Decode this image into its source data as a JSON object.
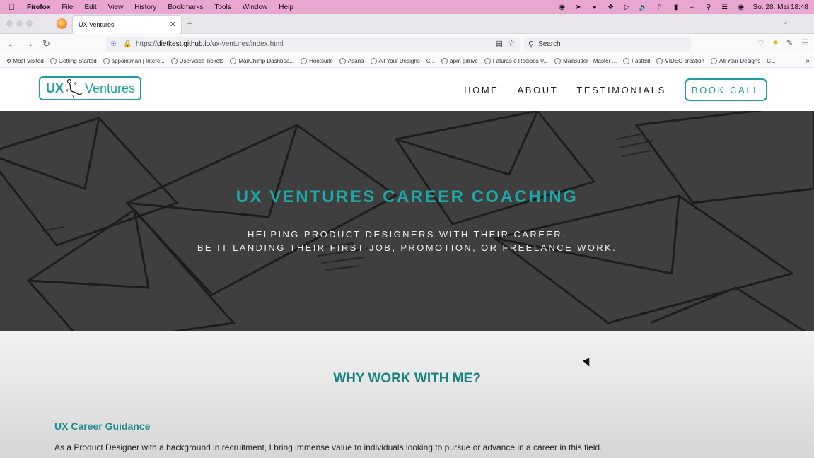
{
  "menubar": {
    "app": "Firefox",
    "items": [
      "File",
      "Edit",
      "View",
      "History",
      "Bookmarks",
      "Tools",
      "Window",
      "Help"
    ],
    "clock": "So. 28. Mai  18:48"
  },
  "browser": {
    "tab_title": "UX Ventures",
    "url_prefix": "https://",
    "url_domain": "dietkest.github.io",
    "url_path": "/ux-ventures/index.html",
    "search_placeholder": "Search"
  },
  "bookmarks": [
    "Most Visited",
    "Getting Started",
    "appointman | Interc...",
    "Uservoice Tickets",
    "MailChimp Dashboa...",
    "Hootsuite",
    "Asana",
    "All Your Designs – C...",
    "apm gdrive",
    "Faturas e Recibos V...",
    "MailButler - Master ...",
    "FastBill",
    "VIDEO creation",
    "All Your Designs – C..."
  ],
  "site": {
    "logo_left": "UX",
    "logo_right": "Ventures",
    "nav": [
      "HOME",
      "ABOUT",
      "TESTIMONIALS"
    ],
    "cta": "BOOK CALL",
    "hero_title": "UX VENTURES CAREER COACHING",
    "hero_line1": "HELPING PRODUCT DESIGNERS WITH THEIR CAREER.",
    "hero_line2": "BE IT LANDING THEIR FIRST JOB, PROMOTION, OR FREELANCE WORK.",
    "why_title": "WHY WORK WITH ME?",
    "section_title": "UX Career Guidance",
    "section_text": "As a Product Designer with a background in recruitment, I bring immense value to individuals looking to pursue or advance in a career in this field."
  },
  "colors": {
    "menubar": "#e9a6d0",
    "accent": "#1f9ea0",
    "heading": "#187f83"
  }
}
